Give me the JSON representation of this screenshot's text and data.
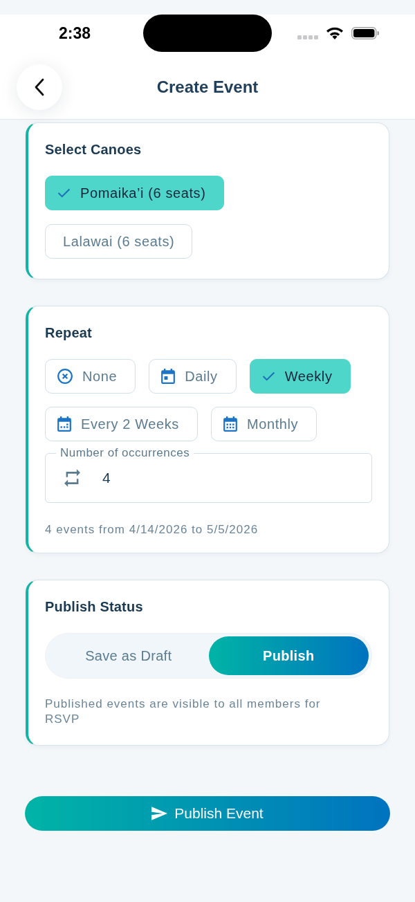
{
  "status_bar": {
    "time": "2:38"
  },
  "header": {
    "title": "Create Event"
  },
  "canoes": {
    "title": "Select Canoes",
    "options": [
      {
        "label": "Pomaika’i (6 seats)",
        "selected": true
      },
      {
        "label": "Lalawai (6 seats)",
        "selected": false
      }
    ]
  },
  "repeat": {
    "title": "Repeat",
    "options": [
      {
        "label": "None",
        "kind": "none",
        "selected": false
      },
      {
        "label": "Daily",
        "kind": "daily",
        "selected": false
      },
      {
        "label": "Weekly",
        "selected": true
      },
      {
        "label": "Every 2 Weeks",
        "kind": "biweekly",
        "selected": false
      },
      {
        "label": "Monthly",
        "kind": "monthly",
        "selected": false
      }
    ],
    "occurrences": {
      "label": "Number of occurrences",
      "value": "4"
    },
    "summary": "4 events from 4/14/2026 to 5/5/2026"
  },
  "publish_status": {
    "title": "Publish Status",
    "options": [
      {
        "label": "Save as Draft",
        "selected": false
      },
      {
        "label": "Publish",
        "selected": true
      }
    ],
    "note": "Published events are visible to all members for RSVP"
  },
  "submit_button": {
    "label": "Publish Event"
  }
}
